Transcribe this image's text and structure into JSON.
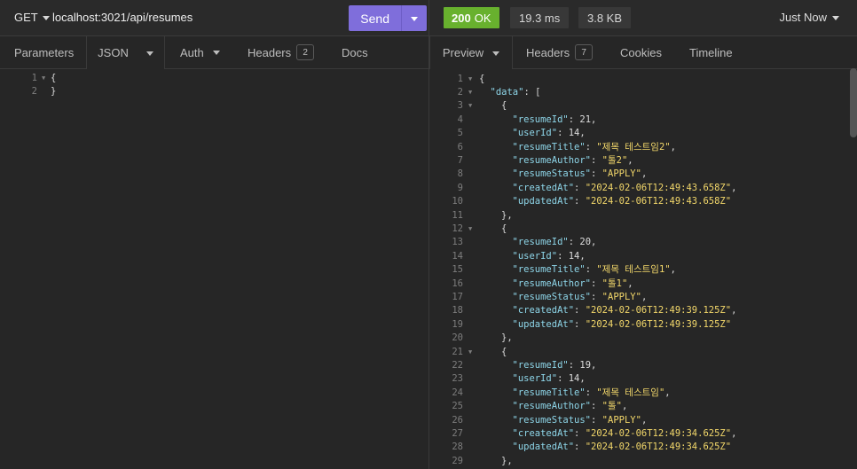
{
  "request": {
    "method": "GET",
    "url": "localhost:3021/api/resumes",
    "send_label": "Send",
    "tabs": [
      {
        "label": "Parameters"
      },
      {
        "label": "JSON"
      },
      {
        "label": "Auth"
      },
      {
        "label": "Headers",
        "badge": "2"
      },
      {
        "label": "Docs"
      }
    ],
    "body_lines": [
      {
        "n": "1",
        "text": "{"
      },
      {
        "n": "2",
        "text": "}"
      }
    ]
  },
  "response": {
    "status_code": "200",
    "status_text": "OK",
    "time": "19.3 ms",
    "size": "3.8 KB",
    "history": "Just Now",
    "tabs": [
      {
        "label": "Preview"
      },
      {
        "label": "Headers",
        "badge": "7"
      },
      {
        "label": "Cookies"
      },
      {
        "label": "Timeline"
      }
    ],
    "lines": [
      {
        "n": "1",
        "fold": true,
        "indent": 0,
        "tokens": [
          [
            "punc",
            "{"
          ]
        ]
      },
      {
        "n": "2",
        "fold": true,
        "indent": 1,
        "tokens": [
          [
            "key",
            "\"data\""
          ],
          [
            "punc",
            ": ["
          ]
        ]
      },
      {
        "n": "3",
        "fold": true,
        "indent": 2,
        "tokens": [
          [
            "punc",
            "{"
          ]
        ]
      },
      {
        "n": "4",
        "indent": 3,
        "tokens": [
          [
            "key",
            "\"resumeId\""
          ],
          [
            "punc",
            ": "
          ],
          [
            "num",
            "21"
          ],
          [
            "punc",
            ","
          ]
        ]
      },
      {
        "n": "5",
        "indent": 3,
        "tokens": [
          [
            "key",
            "\"userId\""
          ],
          [
            "punc",
            ": "
          ],
          [
            "num",
            "14"
          ],
          [
            "punc",
            ","
          ]
        ]
      },
      {
        "n": "6",
        "indent": 3,
        "tokens": [
          [
            "key",
            "\"resumeTitle\""
          ],
          [
            "punc",
            ": "
          ],
          [
            "str",
            "\"제목 테스트임2\""
          ],
          [
            "punc",
            ","
          ]
        ]
      },
      {
        "n": "7",
        "indent": 3,
        "tokens": [
          [
            "key",
            "\"resumeAuthor\""
          ],
          [
            "punc",
            ": "
          ],
          [
            "str",
            "\"톨2\""
          ],
          [
            "punc",
            ","
          ]
        ]
      },
      {
        "n": "8",
        "indent": 3,
        "tokens": [
          [
            "key",
            "\"resumeStatus\""
          ],
          [
            "punc",
            ": "
          ],
          [
            "str",
            "\"APPLY\""
          ],
          [
            "punc",
            ","
          ]
        ]
      },
      {
        "n": "9",
        "indent": 3,
        "tokens": [
          [
            "key",
            "\"createdAt\""
          ],
          [
            "punc",
            ": "
          ],
          [
            "str",
            "\"2024-02-06T12:49:43.658Z\""
          ],
          [
            "punc",
            ","
          ]
        ]
      },
      {
        "n": "10",
        "indent": 3,
        "tokens": [
          [
            "key",
            "\"updatedAt\""
          ],
          [
            "punc",
            ": "
          ],
          [
            "str",
            "\"2024-02-06T12:49:43.658Z\""
          ]
        ]
      },
      {
        "n": "11",
        "indent": 2,
        "tokens": [
          [
            "punc",
            "},"
          ]
        ]
      },
      {
        "n": "12",
        "fold": true,
        "indent": 2,
        "tokens": [
          [
            "punc",
            "{"
          ]
        ]
      },
      {
        "n": "13",
        "indent": 3,
        "tokens": [
          [
            "key",
            "\"resumeId\""
          ],
          [
            "punc",
            ": "
          ],
          [
            "num",
            "20"
          ],
          [
            "punc",
            ","
          ]
        ]
      },
      {
        "n": "14",
        "indent": 3,
        "tokens": [
          [
            "key",
            "\"userId\""
          ],
          [
            "punc",
            ": "
          ],
          [
            "num",
            "14"
          ],
          [
            "punc",
            ","
          ]
        ]
      },
      {
        "n": "15",
        "indent": 3,
        "tokens": [
          [
            "key",
            "\"resumeTitle\""
          ],
          [
            "punc",
            ": "
          ],
          [
            "str",
            "\"제목 테스트임1\""
          ],
          [
            "punc",
            ","
          ]
        ]
      },
      {
        "n": "16",
        "indent": 3,
        "tokens": [
          [
            "key",
            "\"resumeAuthor\""
          ],
          [
            "punc",
            ": "
          ],
          [
            "str",
            "\"톨1\""
          ],
          [
            "punc",
            ","
          ]
        ]
      },
      {
        "n": "17",
        "indent": 3,
        "tokens": [
          [
            "key",
            "\"resumeStatus\""
          ],
          [
            "punc",
            ": "
          ],
          [
            "str",
            "\"APPLY\""
          ],
          [
            "punc",
            ","
          ]
        ]
      },
      {
        "n": "18",
        "indent": 3,
        "tokens": [
          [
            "key",
            "\"createdAt\""
          ],
          [
            "punc",
            ": "
          ],
          [
            "str",
            "\"2024-02-06T12:49:39.125Z\""
          ],
          [
            "punc",
            ","
          ]
        ]
      },
      {
        "n": "19",
        "indent": 3,
        "tokens": [
          [
            "key",
            "\"updatedAt\""
          ],
          [
            "punc",
            ": "
          ],
          [
            "str",
            "\"2024-02-06T12:49:39.125Z\""
          ]
        ]
      },
      {
        "n": "20",
        "indent": 2,
        "tokens": [
          [
            "punc",
            "},"
          ]
        ]
      },
      {
        "n": "21",
        "fold": true,
        "indent": 2,
        "tokens": [
          [
            "punc",
            "{"
          ]
        ]
      },
      {
        "n": "22",
        "indent": 3,
        "tokens": [
          [
            "key",
            "\"resumeId\""
          ],
          [
            "punc",
            ": "
          ],
          [
            "num",
            "19"
          ],
          [
            "punc",
            ","
          ]
        ]
      },
      {
        "n": "23",
        "indent": 3,
        "tokens": [
          [
            "key",
            "\"userId\""
          ],
          [
            "punc",
            ": "
          ],
          [
            "num",
            "14"
          ],
          [
            "punc",
            ","
          ]
        ]
      },
      {
        "n": "24",
        "indent": 3,
        "tokens": [
          [
            "key",
            "\"resumeTitle\""
          ],
          [
            "punc",
            ": "
          ],
          [
            "str",
            "\"제목 테스트임\""
          ],
          [
            "punc",
            ","
          ]
        ]
      },
      {
        "n": "25",
        "indent": 3,
        "tokens": [
          [
            "key",
            "\"resumeAuthor\""
          ],
          [
            "punc",
            ": "
          ],
          [
            "str",
            "\"톨\""
          ],
          [
            "punc",
            ","
          ]
        ]
      },
      {
        "n": "26",
        "indent": 3,
        "tokens": [
          [
            "key",
            "\"resumeStatus\""
          ],
          [
            "punc",
            ": "
          ],
          [
            "str",
            "\"APPLY\""
          ],
          [
            "punc",
            ","
          ]
        ]
      },
      {
        "n": "27",
        "indent": 3,
        "tokens": [
          [
            "key",
            "\"createdAt\""
          ],
          [
            "punc",
            ": "
          ],
          [
            "str",
            "\"2024-02-06T12:49:34.625Z\""
          ],
          [
            "punc",
            ","
          ]
        ]
      },
      {
        "n": "28",
        "indent": 3,
        "tokens": [
          [
            "key",
            "\"updatedAt\""
          ],
          [
            "punc",
            ": "
          ],
          [
            "str",
            "\"2024-02-06T12:49:34.625Z\""
          ]
        ]
      },
      {
        "n": "29",
        "indent": 2,
        "tokens": [
          [
            "punc",
            "},"
          ]
        ]
      }
    ]
  }
}
